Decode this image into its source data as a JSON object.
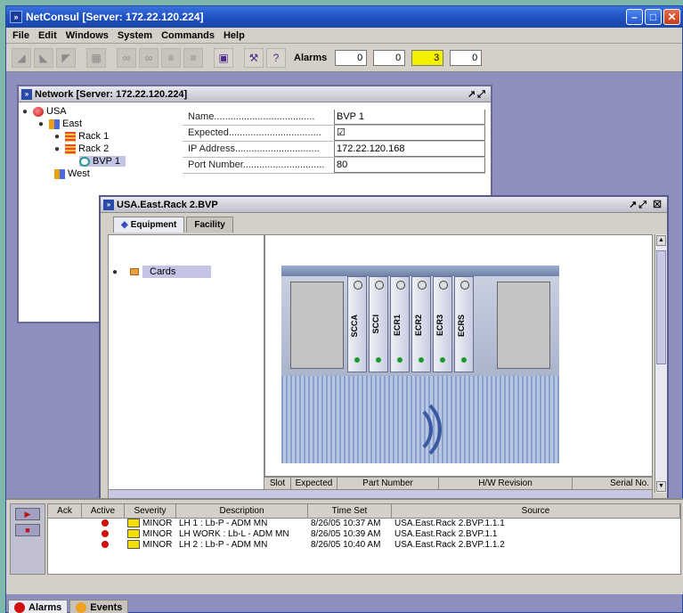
{
  "app": {
    "title": "NetConsul [Server: 172.22.120.224]",
    "icon_glyph": "»",
    "window_buttons": {
      "minimize": "–",
      "maximize": "□",
      "close": "✕"
    }
  },
  "menu": [
    "File",
    "Edit",
    "Windows",
    "System",
    "Commands",
    "Help"
  ],
  "toolbar": {
    "buttons": [
      {
        "name": "align-left-icon",
        "glyph": "◢"
      },
      {
        "name": "align-center-icon",
        "glyph": "◣"
      },
      {
        "name": "align-right-icon",
        "glyph": "◤"
      },
      {
        "name": "grid-icon",
        "glyph": "▦"
      },
      {
        "name": "link-icon",
        "glyph": "∞"
      },
      {
        "name": "link2-icon",
        "glyph": "∞"
      },
      {
        "name": "bracket-icon",
        "glyph": "≡"
      },
      {
        "name": "bracket2-icon",
        "glyph": "≡"
      },
      {
        "name": "monitor-icon",
        "glyph": "▣"
      },
      {
        "name": "tools-icon",
        "glyph": "⚒"
      },
      {
        "name": "help-pointer-icon",
        "glyph": "?"
      }
    ],
    "alarms_label": "Alarms",
    "alarm_counts": [
      "0",
      "0",
      "3",
      "0"
    ]
  },
  "network": {
    "title": "Network [Server: 172.22.120.224]",
    "tree": {
      "root": "USA",
      "east": "East",
      "rack1": "Rack 1",
      "rack2": "Rack 2",
      "bvp1": "BVP 1",
      "west": "West"
    },
    "props": [
      {
        "name": "Name.....................................",
        "value": "BVP 1"
      },
      {
        "name": "Expected..................................",
        "value": "☑"
      },
      {
        "name": "IP Address...............................",
        "value": "172.22.120.168"
      },
      {
        "name": "Port Number..............................",
        "value": "80"
      }
    ]
  },
  "device": {
    "title": "USA.East.Rack 2.BVP",
    "tabs": [
      "Equipment",
      "Facility"
    ],
    "tree_node": "Cards",
    "cards": [
      "SCCA",
      "SCCI",
      "ECR1",
      "ECR2",
      "ECR3",
      "ECRS"
    ],
    "columns": [
      "Slot",
      "Expected",
      "Part Number",
      "H/W Revision",
      "Serial No."
    ]
  },
  "alarms": {
    "columns": [
      "Ack",
      "Active",
      "Severity",
      "Description",
      "Time Set",
      "Source"
    ],
    "rows": [
      {
        "ack": "",
        "severity": "MINOR",
        "description": "LH 1 : Lb-P - ADM MN",
        "time": "8/26/05 10:37 AM",
        "source": "USA.East.Rack 2.BVP.1.1.1"
      },
      {
        "ack": "",
        "severity": "MINOR",
        "description": "LH WORK : Lb-L - ADM MN",
        "time": "8/26/05 10:39 AM",
        "source": "USA.East.Rack 2.BVP.1.1"
      },
      {
        "ack": "",
        "severity": "MINOR",
        "description": "LH 2 : Lb-P - ADM MN",
        "time": "8/26/05 10:40 AM",
        "source": "USA.East.Rack 2.BVP.1.1.2"
      }
    ],
    "bottom_tabs": [
      "Alarms",
      "Events"
    ]
  },
  "colors": {
    "title_blue": "#1e4fbf",
    "alarm_highlight": "#f4f000",
    "severity_minor": "#f4e000",
    "alarm_red": "#d01010",
    "events_orange": "#f0a020"
  }
}
